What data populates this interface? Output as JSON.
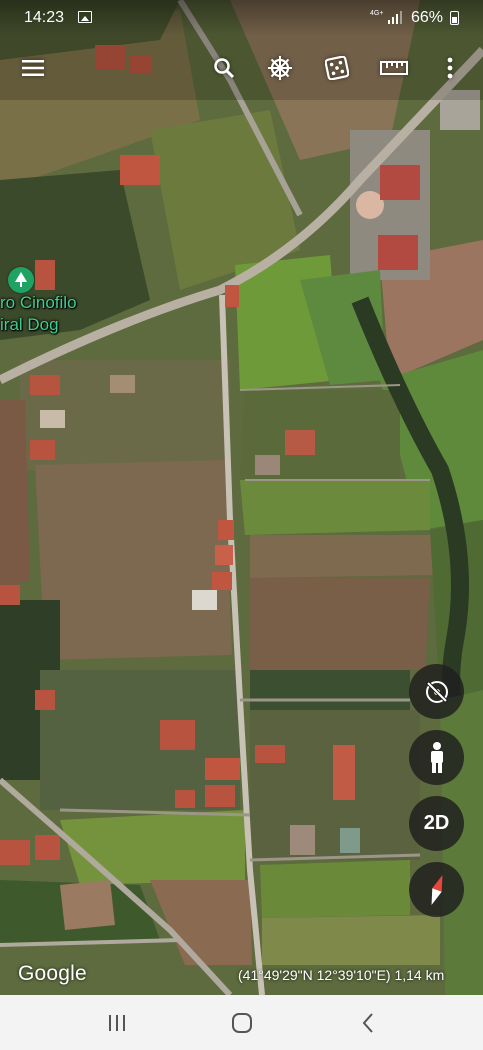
{
  "status_bar": {
    "time": "14:23",
    "network": "4G+",
    "battery": "66%",
    "icons": [
      "gallery-icon",
      "signal-icon",
      "battery-icon"
    ]
  },
  "toolbar": {
    "buttons": [
      "menu-icon",
      "search-icon",
      "voyager-icon",
      "random-dice-icon",
      "measure-ruler-icon",
      "more-vert-icon"
    ]
  },
  "map": {
    "place_label_line1": "ro Cinofilo",
    "place_label_line2": "iral Dog",
    "place_icon": "tree-pin-icon"
  },
  "controls": {
    "reset_view": "reset-orientation-icon",
    "street_view": "pegman-icon",
    "view_mode": "2D",
    "compass": "compass-icon"
  },
  "footer": {
    "logo": "Google",
    "coordinates": "(41°49'29\"N 12°39'10\"E) 1,14 km"
  },
  "navbar": {
    "buttons": [
      "recent-apps-icon",
      "home-icon",
      "back-icon"
    ]
  },
  "colors": {
    "pin_green": "#1fa365",
    "label_green": "#3ecf8e",
    "control_bg": "#1e1e1e",
    "navbar_bg": "#f3f3f3"
  }
}
